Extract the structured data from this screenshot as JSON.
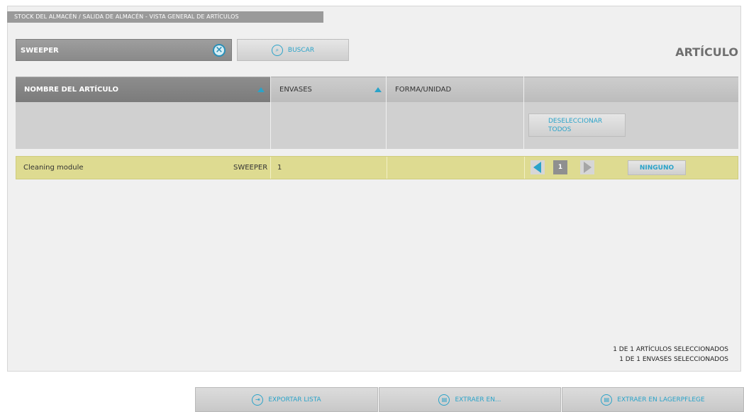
{
  "breadcrumb": "STOCK DEL ALMACÉN / SALIDA DE ALMACÉN - VISTA GENERAL DE ARTÍCULOS",
  "search": {
    "value": "SWEEPER",
    "clear_icon": "x-circle-icon"
  },
  "search_button": {
    "label": "BUSCAR",
    "icon": "magnifier-icon"
  },
  "page_title": "ARTÍCULO",
  "table": {
    "columns": [
      "NOMBRE DEL ARTÍCULO",
      "ENVASES",
      "FORMA/UNIDAD",
      ""
    ],
    "deselect_all": "DESELECCIONAR TODOS",
    "rows": [
      {
        "name": "Cleaning module",
        "code": "SWEEPER",
        "envases": "1",
        "forma": "",
        "page": "1",
        "action": "NINGUNO"
      }
    ]
  },
  "status": {
    "articles": "1 DE 1 ARTÍCULOS SELECCIONADOS",
    "containers": "1 DE 1 ENVASES SELECCIONADOS"
  },
  "footer": {
    "export": "EXPORTAR LISTA",
    "extract_to": "EXTRAER EN...",
    "extract_lager": "EXTRAER EN LAGERPFLEGE"
  },
  "colors": {
    "accent": "#2aa3c9",
    "selected_row": "#dedb91"
  }
}
